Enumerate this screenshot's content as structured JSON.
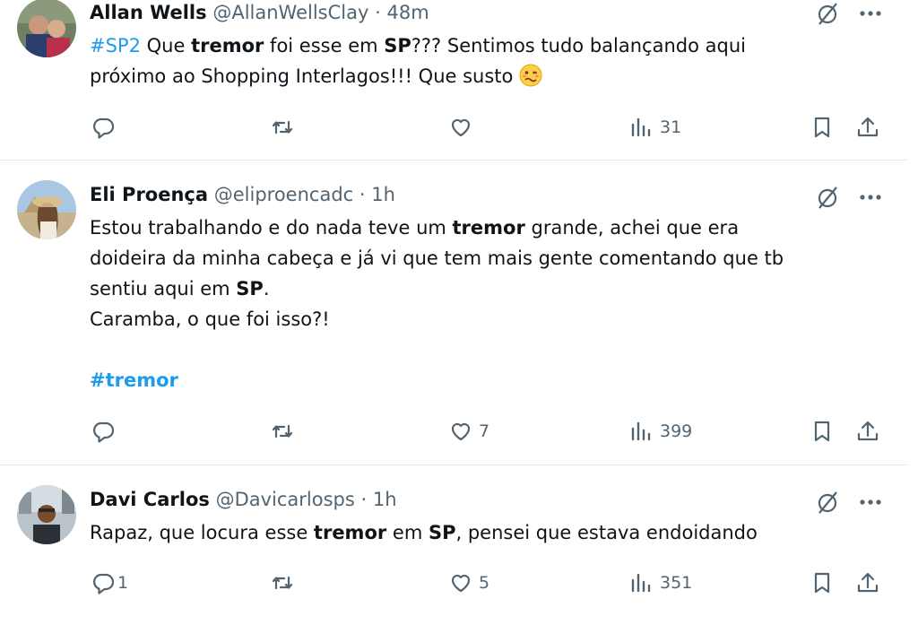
{
  "tweets": [
    {
      "name": "Allan Wells",
      "handle": "@AllanWellsClay",
      "sep": "·",
      "time": "48m",
      "text": {
        "l1a": "#SP2",
        "l1b": " Que ",
        "l1c": "tremor",
        "l1d": " foi esse em ",
        "l1e": "SP",
        "l1f": "??? Sentimos tudo balançando aqui",
        "l2": "próximo ao Shopping Interlagos!!! Que susto "
      },
      "replies": "",
      "retweets": "",
      "likes": "",
      "views": "31"
    },
    {
      "name": "Eli Proença",
      "handle": "@eliproencadc",
      "sep": "·",
      "time": "1h",
      "text": {
        "l1a": "Estou trabalhando e do nada teve um ",
        "l1b": "tremor",
        "l1c": " grande, achei que era",
        "l2": "doideira da minha cabeça e já vi que tem mais gente comentando que tb",
        "l3a": "sentiu aqui em ",
        "l3b": "SP",
        "l3c": ".",
        "l4": "Caramba, o que foi isso?!",
        "hashtag": "#tremor"
      },
      "replies": "",
      "retweets": "",
      "likes": "7",
      "views": "399"
    },
    {
      "name": "Davi Carlos",
      "handle": "@Davicarlosps",
      "sep": "·",
      "time": "1h",
      "text": {
        "l1a": "Rapaz, que locura esse ",
        "l1b": "tremor",
        "l1c": " em ",
        "l1d": "SP",
        "l1e": ", pensei que estava endoidando"
      },
      "replies": "1",
      "retweets": "",
      "likes": "5",
      "views": "351"
    }
  ],
  "colors": {
    "link": "#1d9bf0",
    "muted": "#536471",
    "text": "#0f1419",
    "divider": "#e4e8eb"
  },
  "icons": [
    "reply-icon",
    "retweet-icon",
    "like-icon",
    "views-icon",
    "bookmark-icon",
    "share-icon",
    "grok-icon",
    "more-icon",
    "woozy-face-emoji"
  ]
}
